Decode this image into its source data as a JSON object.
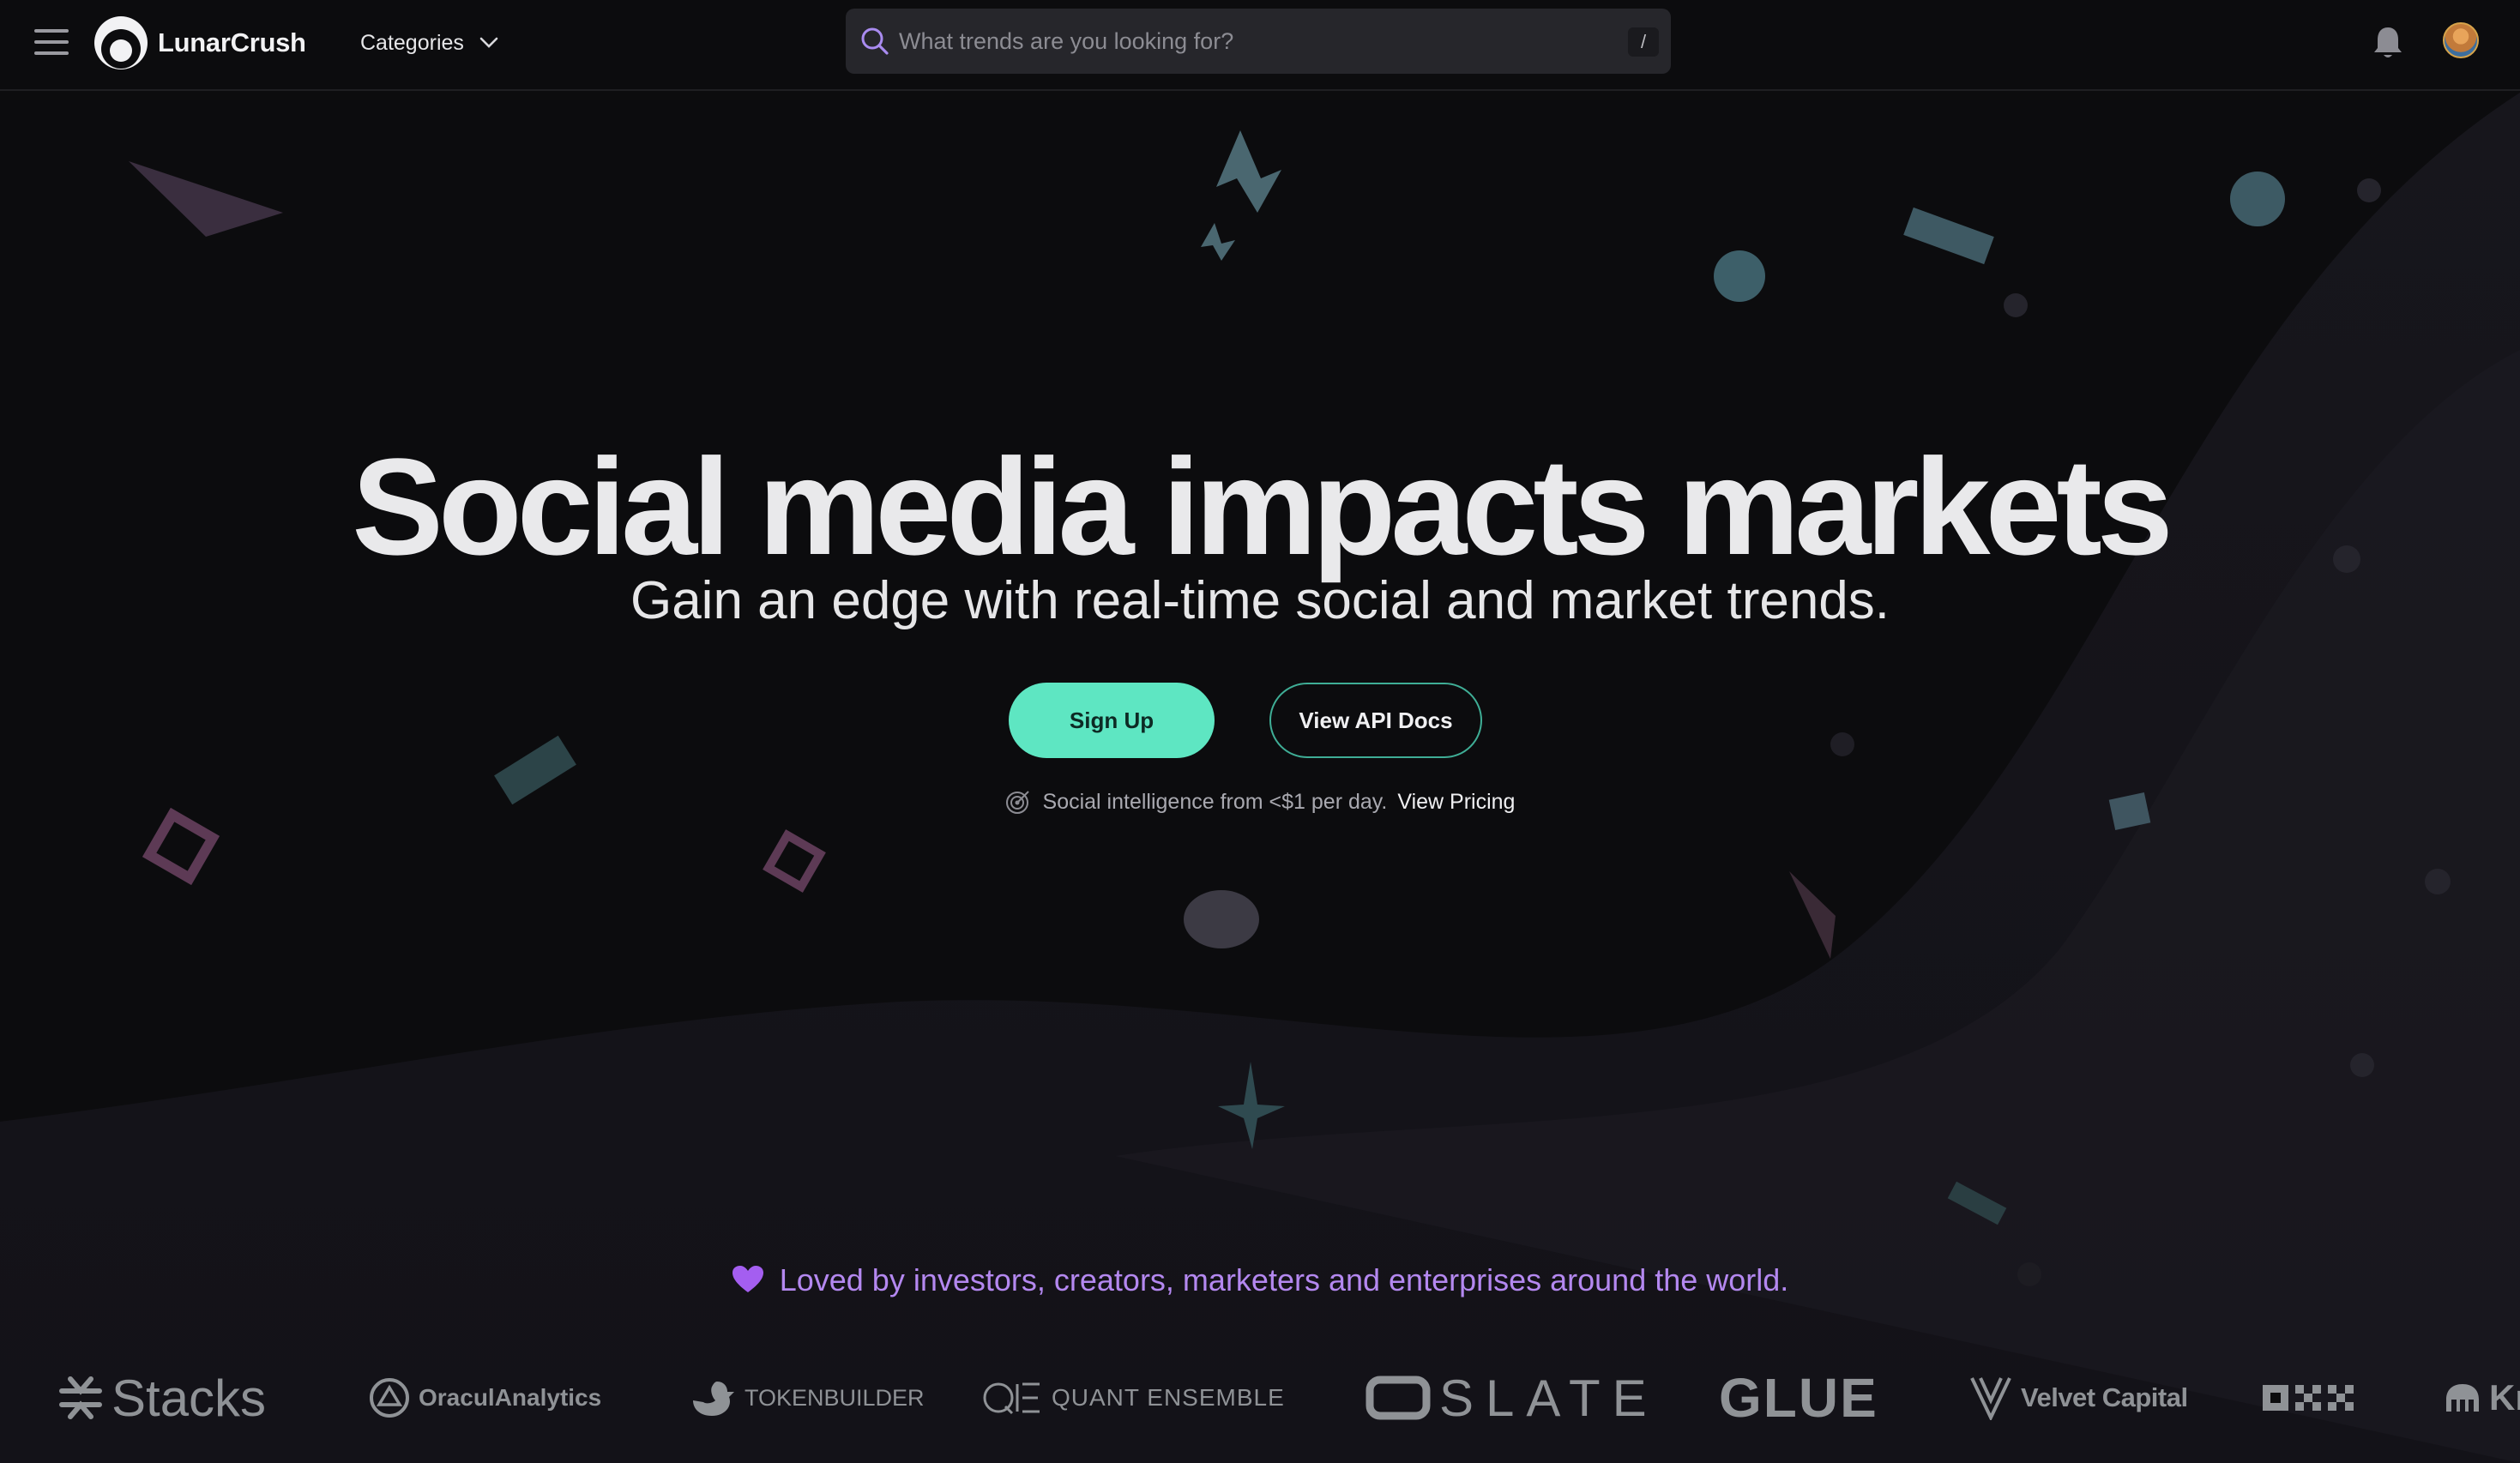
{
  "header": {
    "logo_text": "LunarCrush",
    "categories_label": "Categories",
    "search": {
      "placeholder": "What trends are you looking for?",
      "shortcut": "/"
    }
  },
  "hero": {
    "title": "Social media impacts markets",
    "subtitle": "Gain an edge with real-time social and market trends.",
    "signup_label": "Sign Up",
    "api_docs_label": "View API Docs",
    "pricing_text": "Social intelligence from <$1 per day.",
    "pricing_link": "View Pricing"
  },
  "loved_text": "Loved by investors, creators, marketers and enterprises around the world.",
  "brands": [
    {
      "name": "Stacks"
    },
    {
      "name": "OraculAnalytics"
    },
    {
      "name": "TOKENBUILDER"
    },
    {
      "name": "QUANT ENSEMBLE"
    },
    {
      "name": "SLATE"
    },
    {
      "name": "GLUE"
    },
    {
      "name": "Velvet Capital"
    },
    {
      "name": "OKX"
    },
    {
      "name": "Kr"
    }
  ],
  "colors": {
    "background": "#0c0c0e",
    "accent_green": "#5ee6c2",
    "accent_purple": "#b488f0",
    "search_bg": "#26262b"
  },
  "icons": [
    "menu-icon",
    "crescent-logo-icon",
    "chevron-down-icon",
    "search-icon",
    "bell-icon",
    "avatar",
    "target-icon",
    "heart-icon"
  ]
}
